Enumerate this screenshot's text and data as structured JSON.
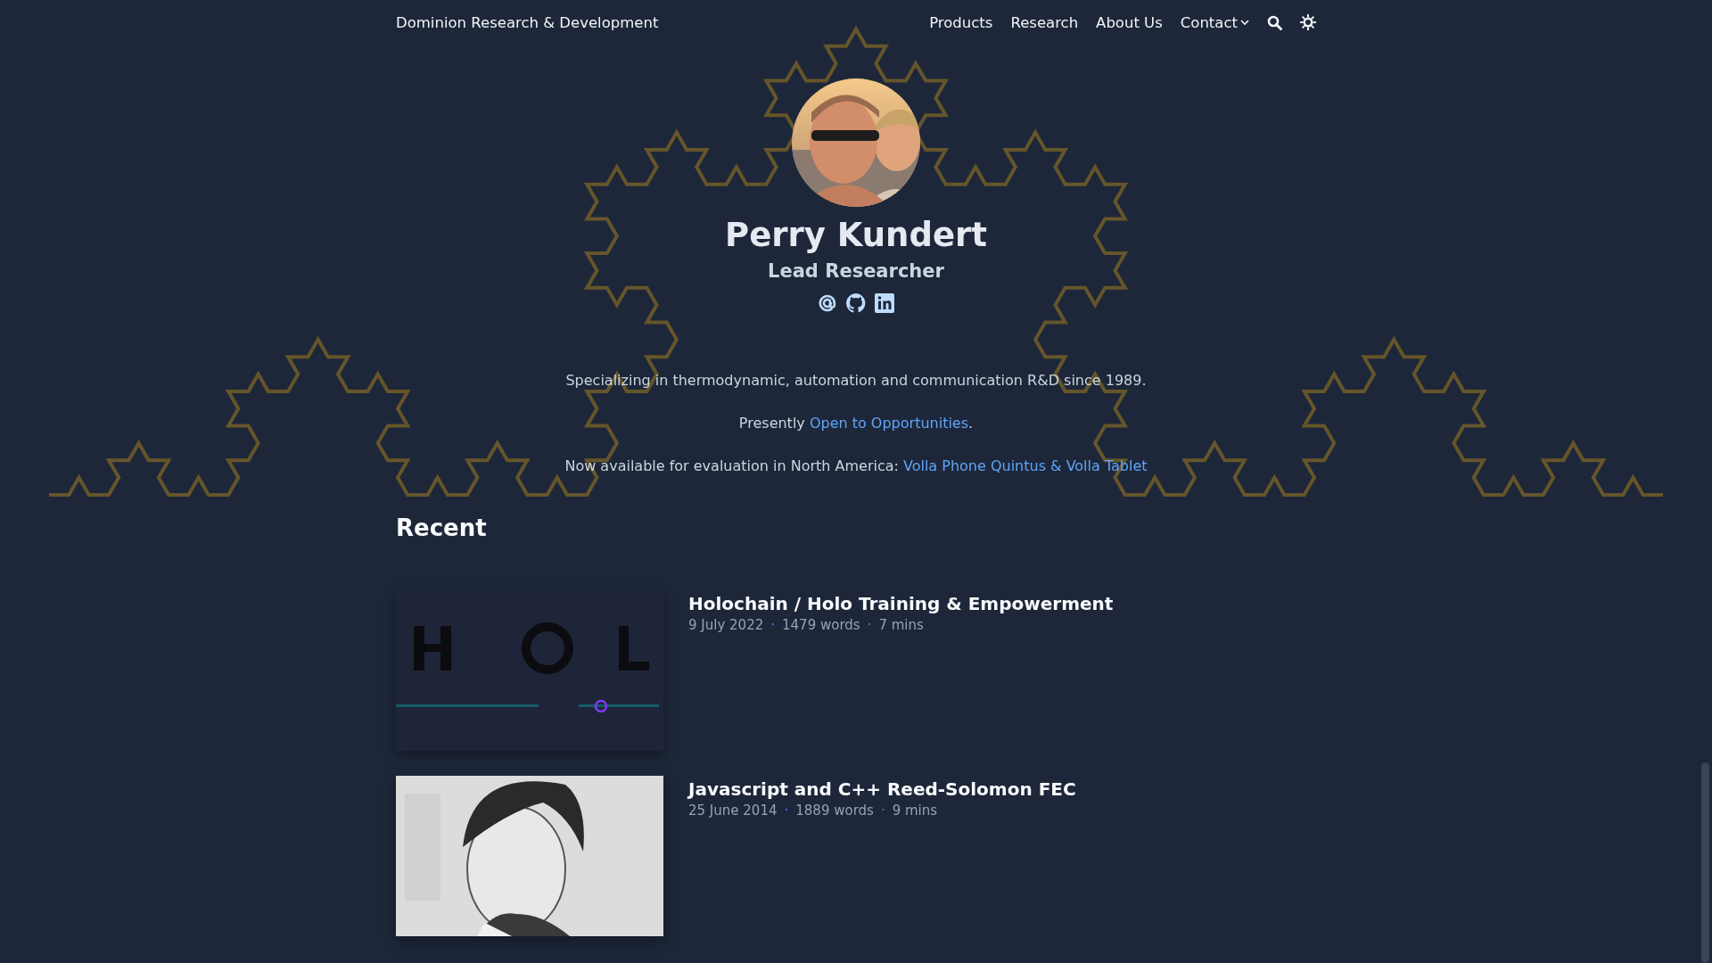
{
  "header": {
    "site_title": "Dominion Research & Development",
    "nav": [
      {
        "label": "Products",
        "kind": "link"
      },
      {
        "label": "Research",
        "kind": "link"
      },
      {
        "label": "About Us",
        "kind": "link"
      },
      {
        "label": "Contact",
        "kind": "dropdown"
      }
    ]
  },
  "profile": {
    "name": "Perry Kundert",
    "role": "Lead Researcher"
  },
  "paragraphs": [
    {
      "parts": [
        {
          "kind": "text",
          "text": "Specializing in thermodynamic, automation and communication R&D since 1989."
        }
      ]
    },
    {
      "parts": [
        {
          "kind": "text",
          "text": "Presently "
        },
        {
          "kind": "link",
          "text": "Open to Opportunities"
        },
        {
          "kind": "text",
          "text": "."
        }
      ]
    },
    {
      "parts": [
        {
          "kind": "text",
          "text": "Now available for evaluation in North America: "
        },
        {
          "kind": "link",
          "text": "Volla Phone Quintus & Volla Tablet"
        }
      ]
    }
  ],
  "recent": {
    "heading": "Recent",
    "posts": [
      {
        "title": "Holochain / Holo Training & Empowerment",
        "meta": [
          {
            "kind": "text",
            "text": "9 July 2022"
          },
          {
            "kind": "dot",
            "text": "·"
          },
          {
            "kind": "text",
            "text": "1479 words"
          },
          {
            "kind": "dot",
            "text": "·"
          },
          {
            "kind": "text",
            "text": "7 mins"
          }
        ]
      },
      {
        "title": "Javascript and C++ Reed-Solomon FEC",
        "meta": [
          {
            "kind": "text",
            "text": "25 June 2014"
          },
          {
            "kind": "dot",
            "text": "·"
          },
          {
            "kind": "text",
            "text": "1889 words"
          },
          {
            "kind": "dot",
            "text": "·"
          },
          {
            "kind": "text",
            "text": "9 mins"
          }
        ]
      }
    ]
  }
}
